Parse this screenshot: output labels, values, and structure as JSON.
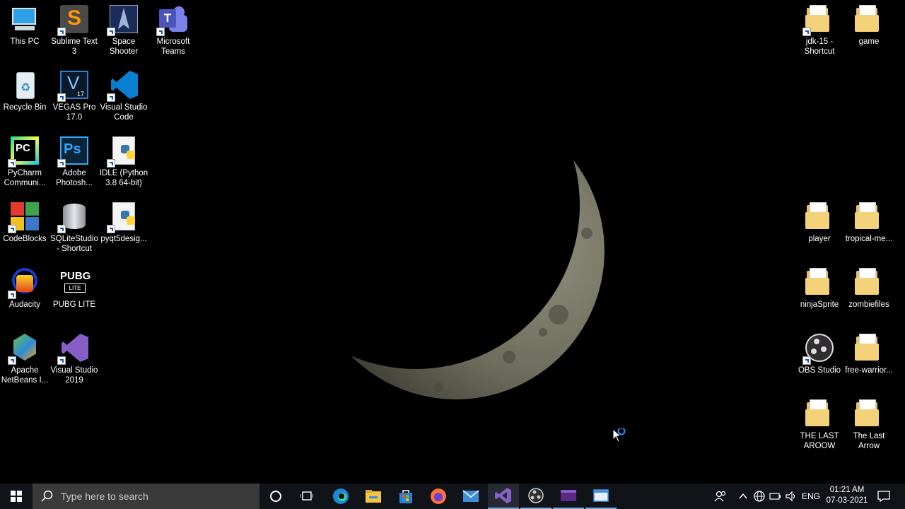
{
  "desktop": {
    "left_icons": [
      {
        "label": "This PC",
        "icon": "this-pc-icon"
      },
      {
        "label": "Recycle Bin",
        "icon": "recycle-bin-icon"
      },
      {
        "label": "PyCharm Communi...",
        "icon": "pycharm-icon"
      },
      {
        "label": "CodeBlocks",
        "icon": "codeblocks-icon"
      },
      {
        "label": "Audacity",
        "icon": "audacity-icon"
      },
      {
        "label": "Apache NetBeans I...",
        "icon": "netbeans-icon"
      },
      {
        "label": "Sublime Text 3",
        "icon": "sublime-text-icon"
      },
      {
        "label": "VEGAS Pro 17.0",
        "icon": "vegas-pro-icon"
      },
      {
        "label": "Adobe Photosh...",
        "icon": "photoshop-icon"
      },
      {
        "label": "SQLiteStudio - Shortcut",
        "icon": "sqlitestudio-icon"
      },
      {
        "label": "PUBG LITE",
        "icon": "pubg-icon"
      },
      {
        "label": "Visual Studio 2019",
        "icon": "visual-studio-icon"
      },
      {
        "label": "Space Shooter",
        "icon": "space-shooter-icon"
      },
      {
        "label": "Visual Studio Code",
        "icon": "vscode-icon"
      },
      {
        "label": "IDLE (Python 3.8 64-bit)",
        "icon": "python-idle-icon"
      },
      {
        "label": "pyqt5desig...",
        "icon": "python-file-icon"
      },
      {
        "label": "Microsoft Teams",
        "icon": "teams-icon"
      }
    ],
    "right_icons": [
      {
        "label": "jdk-15 - Shortcut",
        "icon": "folder-icon"
      },
      {
        "label": "game",
        "icon": "folder-icon"
      },
      {
        "label": "player",
        "icon": "folder-icon"
      },
      {
        "label": "tropical-me...",
        "icon": "folder-icon"
      },
      {
        "label": "ninjaSprite",
        "icon": "folder-icon"
      },
      {
        "label": "zombiefiles",
        "icon": "folder-icon"
      },
      {
        "label": "OBS Studio",
        "icon": "obs-icon"
      },
      {
        "label": "free-warrior...",
        "icon": "folder-icon"
      },
      {
        "label": "THE LAST AROOW",
        "icon": "folder-icon"
      },
      {
        "label": "The Last Arrow",
        "icon": "folder-icon"
      }
    ]
  },
  "taskbar": {
    "search_placeholder": "Type here to search",
    "apps": [
      "start-icon",
      "cortana-icon",
      "task-view-icon",
      "edge-icon",
      "file-explorer-icon",
      "store-icon",
      "firefox-icon",
      "mail-icon",
      "visual-studio-icon",
      "obs-icon",
      "media-player-icon",
      "window-app-icon"
    ],
    "language": "ENG",
    "time": "01:21 AM",
    "date": "07-03-2021"
  },
  "colors": {
    "taskbar": "#101418",
    "search_box": "#3a3a3a",
    "desktop": "#000000"
  }
}
